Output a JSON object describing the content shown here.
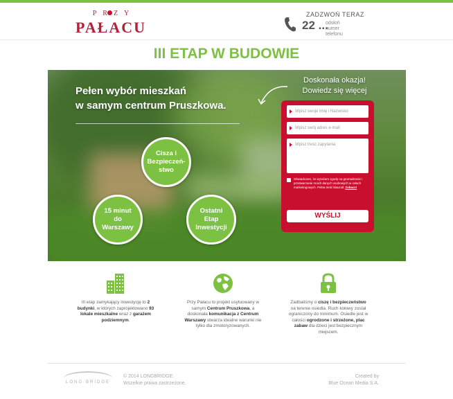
{
  "header": {
    "logo_small": "PRZY",
    "logo_big": "PAŁACU",
    "call_label": "ZADZWOŃ TERAZ",
    "call_number": "22 ...",
    "call_reveal": "odsłoń numer telefonu"
  },
  "headline": "III ETAP W BUDOWIE",
  "hero": {
    "title_line1": "Pełen wybór mieszkań",
    "title_line2": "w samym centrum Pruszkowa.",
    "bubbles": [
      "Cisza i\nBezpieczeń-\nstwo",
      "15 minut\ndo\nWarszawy",
      "Ostatni\nEtap\nInwestycji"
    ],
    "deal_line1": "Doskonała okazja!",
    "deal_line2": "Dowiedz się więcej"
  },
  "form": {
    "name_placeholder": "Wpisz swoje Imię i Nazwisko",
    "email_placeholder": "Wpisz swój adres e-mail",
    "question_placeholder": "Wpisz treść zapytania",
    "consent_text": "Oświadczam, że wyrażam zgodę na gromadzenie i przetwarzanie moich danych osobowych w celach marketingowych. Pełna treść klauzuli:",
    "consent_more": "Zobacz!",
    "submit_label": "WYŚLIJ"
  },
  "features": [
    {
      "icon": "buildings-icon",
      "p1": "III etap zamykający inwestycję to ",
      "b1": "2 budynki",
      "p2": ", w których zaprojektowano ",
      "b2": "93 lokale mieszkalne",
      "p3": " wraz z ",
      "b3": "garażem podziemnym",
      "p4": "."
    },
    {
      "icon": "globe-icon",
      "p1": "Przy Pałacu to projekt usytuowany w samym ",
      "b1": "Centrum Pruszkowa",
      "p2": ", a doskonała ",
      "b2": "komunikacja z Centrum Warszawy",
      "p3": " stwarza idealne warunki nie tylko dla zmotoryzowanych.",
      "b3": "",
      "p4": ""
    },
    {
      "icon": "padlock-icon",
      "p1": "Zadbaliśmy o ",
      "b1": "ciszę i bezpieczeństwo",
      "p2": " na terenie osiedla. Ruch kołowy został ograniczony do minimum. Osiedle jest w całości ",
      "b2": "ogrodzone i strzeżone, plac zabaw",
      "p3": " dla dzieci jest bezpiecznym miejscem.",
      "b3": "",
      "p4": ""
    }
  ],
  "footer": {
    "logo_text": "LONG·BRIDGE",
    "copy_line1": "© 2014 LONGBRIDGE.",
    "copy_line2": "Wszelkie prawa zastrzeżone.",
    "credit_line1": "Created by",
    "credit_line2": "Blue Ocean Media S.A."
  },
  "colors": {
    "accent_green": "#7cc142",
    "brand_red": "#c8102e"
  }
}
